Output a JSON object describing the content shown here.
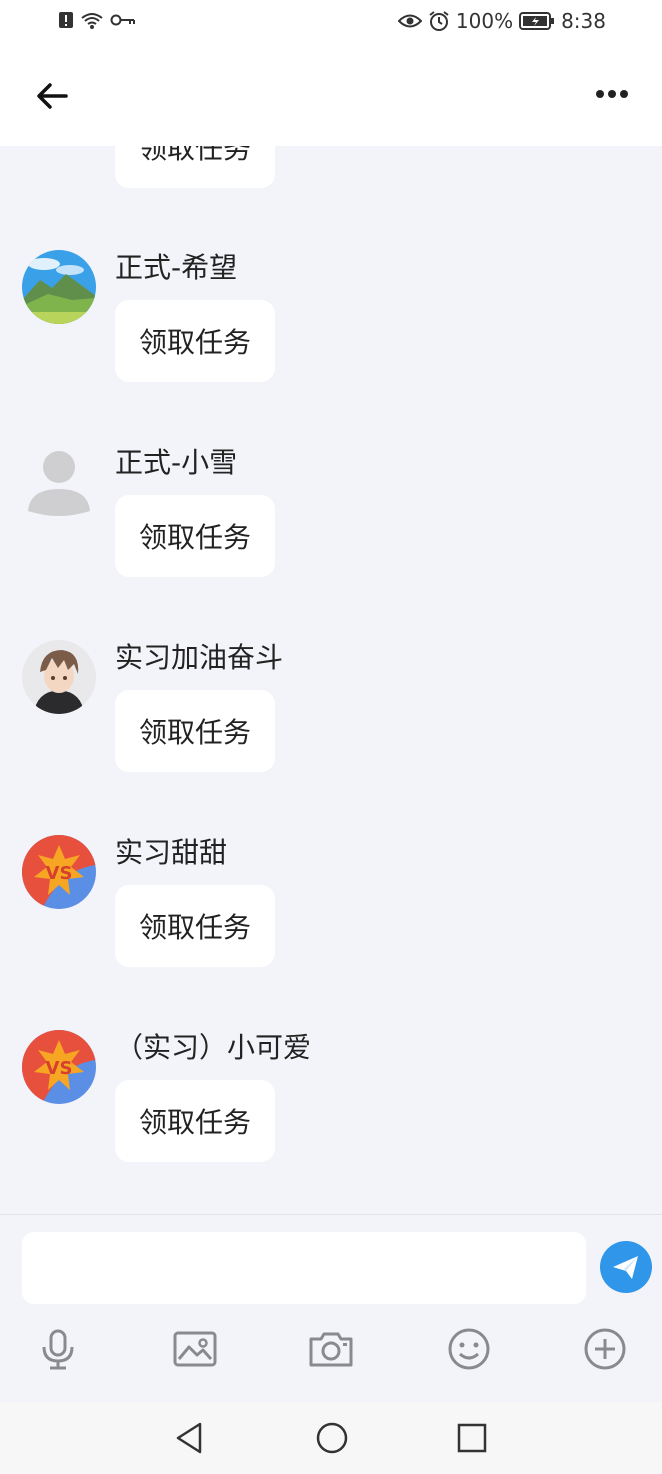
{
  "status_bar": {
    "battery": "100%",
    "time": "8:38",
    "icons": [
      "alert-icon",
      "wifi-icon",
      "key-icon",
      "eye-icon",
      "alarm-icon",
      "battery-charging-icon"
    ]
  },
  "header": {
    "back_icon": "arrow-left-icon",
    "more_icon": "more-dots-icon"
  },
  "messages": [
    {
      "sender": "",
      "text": "领取任务",
      "avatar": "partial"
    },
    {
      "sender": "正式-希望",
      "text": "领取任务",
      "avatar": "landscape"
    },
    {
      "sender": "正式-小雪",
      "text": "领取任务",
      "avatar": "default-person"
    },
    {
      "sender": "实习加油奋斗",
      "text": "领取任务",
      "avatar": "anime-boy"
    },
    {
      "sender": "实习甜甜",
      "text": "领取任务",
      "avatar": "vs-badge"
    },
    {
      "sender": "（实习）小可爱",
      "text": "领取任务",
      "avatar": "vs-badge"
    }
  ],
  "composer": {
    "input_value": "",
    "send_icon": "paper-plane-icon",
    "tools": [
      "microphone-icon",
      "image-icon",
      "camera-icon",
      "emoji-icon",
      "plus-circle-icon"
    ]
  },
  "nav": [
    "back-triangle-icon",
    "home-circle-icon",
    "recents-square-icon"
  ],
  "colors": {
    "accent": "#2f96ea",
    "background": "#f3f4f9",
    "bubble": "#ffffff"
  }
}
